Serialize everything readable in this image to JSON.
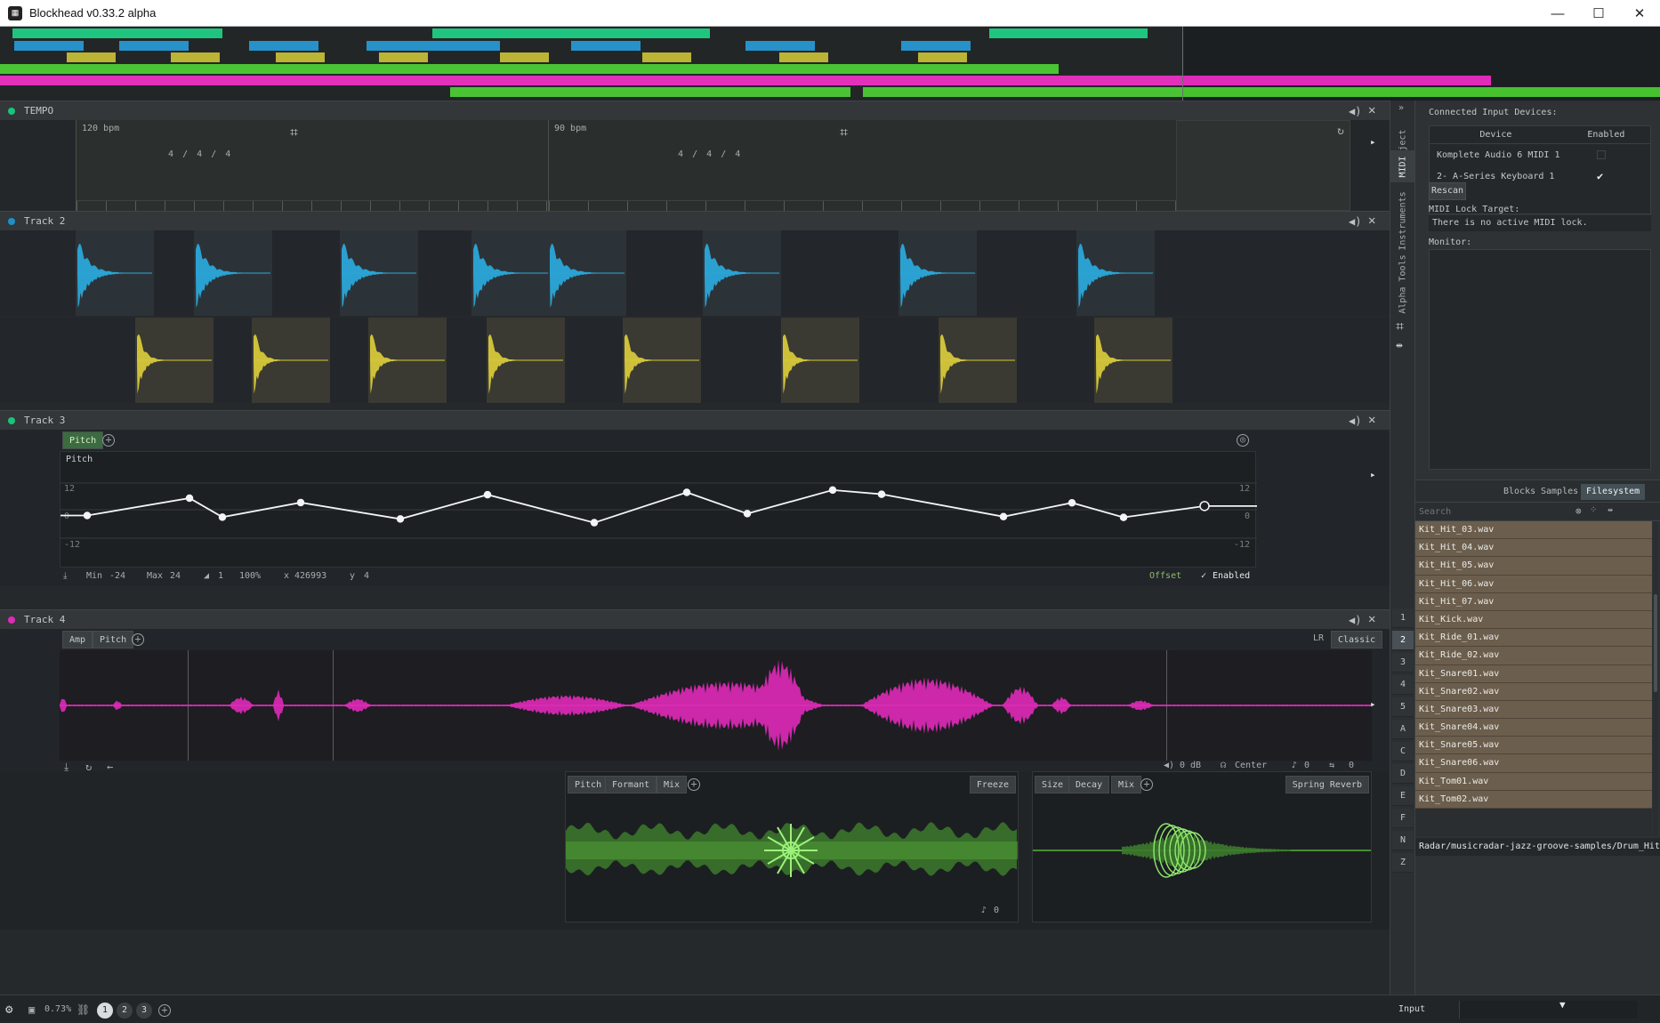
{
  "window": {
    "title": "Blockhead v0.33.2 alpha",
    "minimize": "—",
    "maximize": "☐",
    "close": "✕"
  },
  "colors": {
    "track2": "#1f8fc8",
    "track3": "#18c47a",
    "track4": "#e02ab8",
    "sample_blue": "#2aa8d8",
    "sample_yellow": "#d6c83a",
    "effect_green": "#5bd13f"
  },
  "tracks": {
    "tempo": {
      "name": "TEMPO",
      "segments": [
        {
          "bpm": "120 bpm",
          "sig": [
            "4",
            "/",
            "4",
            "/",
            "4"
          ]
        },
        {
          "bpm": "90 bpm",
          "sig": [
            "4",
            "/",
            "4",
            "/",
            "4"
          ]
        }
      ]
    },
    "track2": {
      "name": "Track 2"
    },
    "track3": {
      "name": "Track 3",
      "param_tab": "Pitch",
      "lane_label": "Pitch",
      "scale_top": "12",
      "scale_mid": "0",
      "scale_bot": "-12",
      "points_y": [
        -2.5,
        5.0,
        -3.2,
        3.1,
        -4.0,
        6.5,
        -5.6,
        7.5,
        -1.7,
        8.5,
        6.7,
        -3.0,
        3.0,
        -3.3,
        1.6
      ],
      "footer": {
        "min_label": "Min",
        "min_value": "-24",
        "max_label": "Max",
        "max_value": "24",
        "step_value": "1",
        "percent_value": "100%",
        "x_label": "x",
        "x_value": "426993",
        "y_label": "y",
        "y_value": "4",
        "offset_label": "Offset",
        "enabled_label": "Enabled"
      }
    },
    "track4": {
      "name": "Track 4",
      "tabs": [
        "Amp",
        "Pitch"
      ],
      "mode_lr": "LR",
      "mode_classic": "Classic",
      "footer": {
        "gain": "0 dB",
        "pan": "Center",
        "pitch": "0",
        "offset": "0"
      },
      "effects": {
        "pitch": {
          "tabs": [
            "Pitch",
            "Formant",
            "Mix"
          ],
          "name": "Freeze",
          "footer_value": "0"
        },
        "reverb": {
          "tabs": [
            "Size",
            "Decay",
            "Mix"
          ],
          "name": "Spring Reverb"
        }
      }
    }
  },
  "vertical_tabs": [
    "Project",
    "MIDI",
    "Instruments",
    "Alpha Tools"
  ],
  "number_tabs": [
    "1",
    "2",
    "3",
    "4",
    "5",
    "A",
    "C",
    "D",
    "E",
    "F",
    "N",
    "Z"
  ],
  "right_panel": {
    "connected_title": "Connected Input Devices:",
    "device_col": "Device",
    "enabled_col": "Enabled",
    "devices": [
      {
        "name": "Komplete Audio 6 MIDI 1",
        "enabled": false
      },
      {
        "name": "2- A-Series Keyboard 1",
        "enabled": true
      }
    ],
    "rescan": "Rescan",
    "midi_lock_title": "MIDI Lock Target:",
    "midi_lock_value": "There is no active MIDI lock.",
    "monitor_title": "Monitor:",
    "browser_tabs": [
      "Blocks",
      "Samples",
      "Filesystem"
    ],
    "search_placeholder": "Search",
    "files": [
      "Kit_Hit_03.wav",
      "Kit_Hit_04.wav",
      "Kit_Hit_05.wav",
      "Kit_Hit_06.wav",
      "Kit_Hit_07.wav",
      "Kit_Kick.wav",
      "Kit_Ride_01.wav",
      "Kit_Ride_02.wav",
      "Kit_Snare01.wav",
      "Kit_Snare02.wav",
      "Kit_Snare03.wav",
      "Kit_Snare04.wav",
      "Kit_Snare05.wav",
      "Kit_Snare06.wav",
      "Kit_Tom01.wav",
      "Kit_Tom02.wav"
    ],
    "path": "Radar/musicradar-jazz-groove-samples/Drum_Hits"
  },
  "statusbar": {
    "zoom": "0.73%",
    "pages": [
      "1",
      "2",
      "3"
    ],
    "input": "Input"
  }
}
